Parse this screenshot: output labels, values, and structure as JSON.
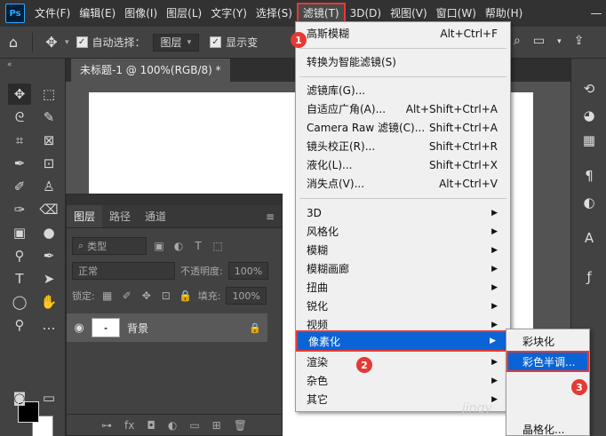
{
  "app": {
    "logo": "Ps"
  },
  "menubar": {
    "items": [
      "文件(F)",
      "编辑(E)",
      "图像(I)",
      "图层(L)",
      "文字(Y)",
      "选择(S)",
      "滤镜(T)",
      "3D(D)",
      "视图(V)",
      "窗口(W)",
      "帮助(H)"
    ],
    "active_index": 6
  },
  "options": {
    "auto_select_label": "自动选择：",
    "auto_select_value": "图层",
    "show_transform_label": "显示变"
  },
  "document": {
    "tab_title": "未标题-1 @ 100%(RGB/8) *"
  },
  "layers_panel": {
    "tabs": [
      "图层",
      "路径",
      "通道"
    ],
    "kind_label": "类型",
    "blend_mode": "正常",
    "opacity_label": "不透明度:",
    "opacity_value": "100%",
    "lock_label": "锁定:",
    "fill_label": "填充:",
    "fill_value": "100%",
    "layer_name": "背景"
  },
  "filter_menu": {
    "items": [
      {
        "label": "高斯模糊",
        "shortcut": "Alt+Ctrl+F"
      },
      {
        "label": "转换为智能滤镜(S)",
        "shortcut": ""
      },
      {
        "label": "滤镜库(G)...",
        "shortcut": ""
      },
      {
        "label": "自适应广角(A)...",
        "shortcut": "Alt+Shift+Ctrl+A"
      },
      {
        "label": "Camera Raw 滤镜(C)...",
        "shortcut": "Shift+Ctrl+A"
      },
      {
        "label": "镜头校正(R)...",
        "shortcut": "Shift+Ctrl+R"
      },
      {
        "label": "液化(L)...",
        "shortcut": "Shift+Ctrl+X"
      },
      {
        "label": "消失点(V)...",
        "shortcut": "Alt+Ctrl+V"
      },
      {
        "label": "3D",
        "shortcut": ""
      },
      {
        "label": "风格化",
        "shortcut": ""
      },
      {
        "label": "模糊",
        "shortcut": ""
      },
      {
        "label": "模糊画廊",
        "shortcut": ""
      },
      {
        "label": "扭曲",
        "shortcut": ""
      },
      {
        "label": "锐化",
        "shortcut": ""
      },
      {
        "label": "视频",
        "shortcut": ""
      },
      {
        "label": "像素化",
        "shortcut": ""
      },
      {
        "label": "渲染",
        "shortcut": ""
      },
      {
        "label": "杂色",
        "shortcut": ""
      },
      {
        "label": "其它",
        "shortcut": ""
      }
    ],
    "highlighted": "像素化"
  },
  "submenu": {
    "items": [
      "彩块化",
      "彩色半调...",
      "晶格化..."
    ],
    "highlighted": "彩色半调..."
  },
  "callouts": [
    "1",
    "2",
    "3"
  ],
  "watermark": "jingy",
  "colors": {
    "highlight": "#0a64d6",
    "callout": "#e53935"
  }
}
